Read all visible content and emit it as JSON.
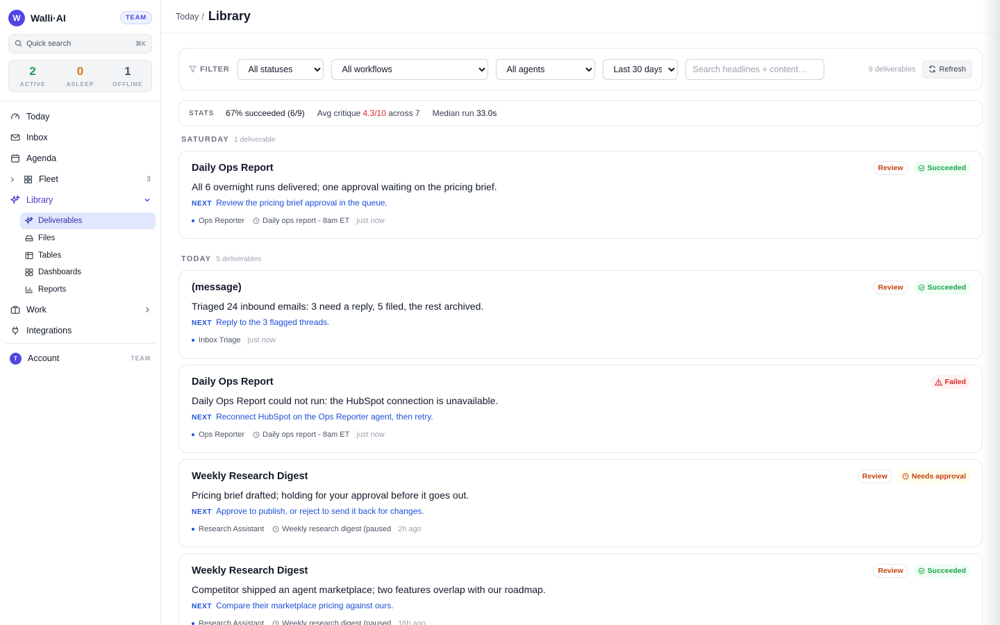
{
  "app": {
    "logo_letter": "W",
    "name": "Walli·AI",
    "plan": "TEAM"
  },
  "sidebar": {
    "quick_search": {
      "label": "Quick search",
      "shortcut": "⌘K"
    },
    "fleet": [
      {
        "count": "2",
        "label": "ACTIVE",
        "color": "#16a34a"
      },
      {
        "count": "0",
        "label": "ASLEEP",
        "color": "#d97706"
      },
      {
        "count": "1",
        "label": "OFFLINE",
        "color": "#475569"
      }
    ],
    "nav": [
      {
        "label": "Today",
        "icon": "gauge-icon"
      },
      {
        "label": "Inbox",
        "icon": "mail-icon"
      },
      {
        "label": "Agenda",
        "icon": "calendar-icon"
      },
      {
        "label": "Fleet",
        "icon": "grid-icon",
        "badge": "3"
      },
      {
        "label": "Library",
        "icon": "sparkles-icon"
      },
      {
        "label": "Work",
        "icon": "briefcase-icon"
      },
      {
        "label": "Integrations",
        "icon": "plug-icon"
      }
    ],
    "library_sub": [
      {
        "label": "Deliverables",
        "icon": "sparkles-icon"
      },
      {
        "label": "Files",
        "icon": "drive-icon"
      },
      {
        "label": "Tables",
        "icon": "table-icon"
      },
      {
        "label": "Dashboards",
        "icon": "dashboard-icon"
      },
      {
        "label": "Reports",
        "icon": "bar-chart-icon"
      }
    ],
    "account": {
      "avatar_letter": "T",
      "label": "Account",
      "plan": "TEAM"
    }
  },
  "header": {
    "breadcrumb_parent": "Today",
    "separator": "/",
    "title": "Library"
  },
  "filters": {
    "label": "FILTER",
    "status": {
      "selected": "All statuses"
    },
    "workflow": {
      "selected": "All workflows"
    },
    "agent": {
      "selected": "All agents"
    },
    "range": {
      "selected": "Last 30 days"
    },
    "search_placeholder": "Search headlines + content…",
    "count_text": "9 deliverables",
    "refresh_label": "Refresh"
  },
  "stats": {
    "label": "STATS",
    "succeeded": "67% succeeded (6/9)",
    "critique_prefix": "Avg critique",
    "critique_value": "4.3/10",
    "critique_suffix": "across 7",
    "median_prefix": "Median run",
    "median_value": "33.0s"
  },
  "groups": [
    {
      "name": "SATURDAY",
      "count": "1 deliverable",
      "items": [
        {
          "title": "Daily Ops Report",
          "summary": "All 6 overnight runs delivered; one approval waiting on the pricing brief.",
          "next_label": "NEXT",
          "next": "Review the pricing brief approval in the queue.",
          "agent": "Ops Reporter",
          "schedule": "Daily ops report - 8am ET",
          "time": "just now",
          "review": "Review",
          "status": "Succeeded"
        }
      ]
    },
    {
      "name": "TODAY",
      "count": "5 deliverables",
      "items": [
        {
          "title": "(message)",
          "summary": "Triaged 24 inbound emails: 3 need a reply, 5 filed, the rest archived.",
          "next_label": "NEXT",
          "next": "Reply to the 3 flagged threads.",
          "agent": "Inbox Triage",
          "time": "just now",
          "review": "Review",
          "status": "Succeeded"
        },
        {
          "title": "Daily Ops Report",
          "summary": "Daily Ops Report could not run: the HubSpot connection is unavailable.",
          "next_label": "NEXT",
          "next": "Reconnect HubSpot on the Ops Reporter agent, then retry.",
          "agent": "Ops Reporter",
          "schedule": "Daily ops report - 8am ET",
          "time": "just now",
          "status": "Failed"
        },
        {
          "title": "Weekly Research Digest",
          "summary": "Pricing brief drafted; holding for your approval before it goes out.",
          "next_label": "NEXT",
          "next": "Approve to publish, or reject to send it back for changes.",
          "agent": "Research Assistant",
          "schedule": "Weekly research digest (paused",
          "time": "2h ago",
          "review": "Review",
          "status": "Needs approval"
        },
        {
          "title": "Weekly Research Digest",
          "summary": "Competitor shipped an agent marketplace; two features overlap with our roadmap.",
          "next_label": "NEXT",
          "next": "Compare their marketplace pricing against ours.",
          "agent": "Research Assistant",
          "schedule": "Weekly research digest (paused",
          "time": "16h ago",
          "review": "Review",
          "status": "Succeeded"
        }
      ]
    }
  ],
  "colors": {
    "accent": "#4f46e5",
    "link": "#1d4ed8",
    "success": "#16a34a",
    "danger": "#dc2626",
    "warning": "#c2410c"
  }
}
